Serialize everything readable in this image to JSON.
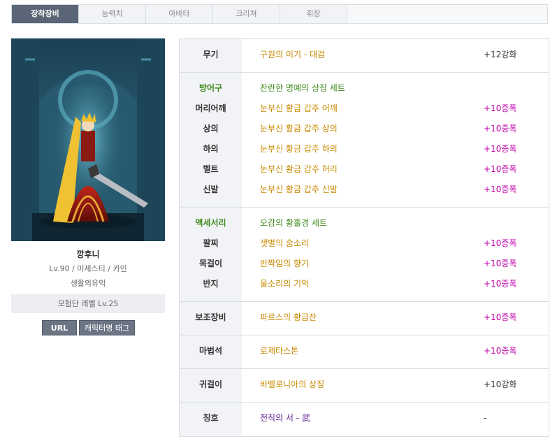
{
  "tabs": [
    "장착장비",
    "능력치",
    "아바타",
    "크리쳐",
    "휘장"
  ],
  "profile": {
    "name": "깡후니",
    "info": "Lv.90 / 마제스티 / 카인",
    "guild": "생활의유익",
    "adventure_level": "모험단 레벨 Lv.25",
    "url_button": "URL",
    "tag_button": "캐릭터명 태그"
  },
  "weapon": {
    "slot": "무기",
    "name": "구원의 이기 - 대검",
    "enh": "+12강화"
  },
  "armor": {
    "label": "방어구",
    "set": "찬란한 명예의 상징 세트",
    "items": [
      {
        "slot": "머리어깨",
        "name": "눈부신 황금 갑주 어깨",
        "enh": "+10증폭"
      },
      {
        "slot": "상의",
        "name": "눈부신 황금 갑주 상의",
        "enh": "+10증폭"
      },
      {
        "slot": "하의",
        "name": "눈부신 황금 갑주 하의",
        "enh": "+10증폭"
      },
      {
        "slot": "벨트",
        "name": "눈부신 황금 갑주 허리",
        "enh": "+10증폭"
      },
      {
        "slot": "신발",
        "name": "눈부신 황금 갑주 신발",
        "enh": "+10증폭"
      }
    ]
  },
  "accessory": {
    "label": "액세서리",
    "set": "오감의 황홀경 세트",
    "items": [
      {
        "slot": "팔찌",
        "name": "샛별의 숨소리",
        "enh": "+10증폭"
      },
      {
        "slot": "목걸이",
        "name": "반짝임의 향기",
        "enh": "+10증폭"
      },
      {
        "slot": "반지",
        "name": "물소리의 기억",
        "enh": "+10증폭"
      }
    ]
  },
  "support": {
    "slot": "보조장비",
    "name": "파르스의 황금잔",
    "enh": "+10증폭"
  },
  "magicstone": {
    "slot": "마법석",
    "name": "로제타스톤",
    "enh": "+10증폭"
  },
  "earring": {
    "slot": "귀걸이",
    "name": "바벨로니아의 상징",
    "enh": "+10강화"
  },
  "title": {
    "slot": "칭호",
    "name": "전직의 서 - 武",
    "enh": "-"
  },
  "colors": {
    "tab_active": "#5a6677",
    "item_gold": "#c88a00",
    "set_green": "#3f8a1c",
    "amp_purple": "#c000a8",
    "title_purple": "#5a1a8c"
  }
}
